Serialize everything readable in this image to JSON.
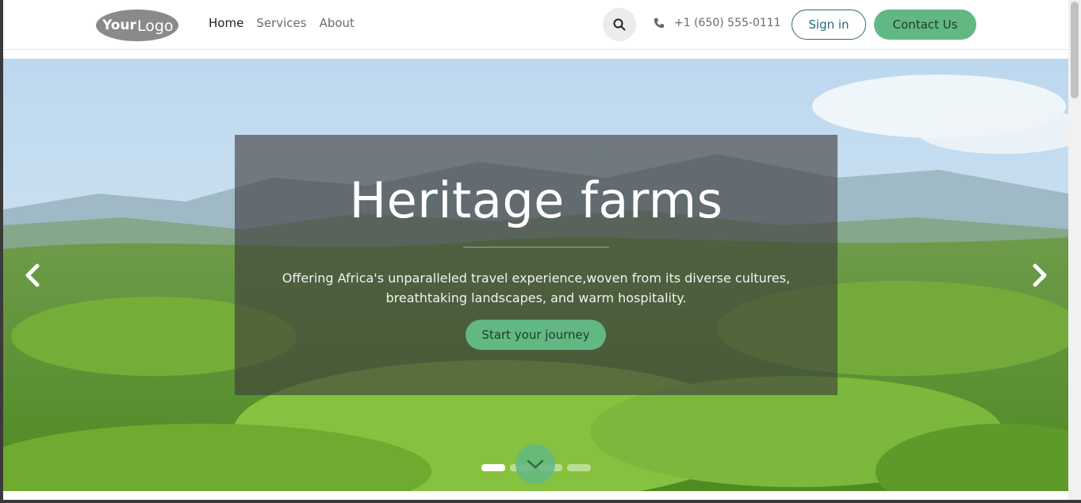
{
  "header": {
    "logo_text_bold": "Your",
    "logo_text": "Logo",
    "nav": [
      {
        "label": "Home",
        "active": true
      },
      {
        "label": "Services",
        "active": false
      },
      {
        "label": "About",
        "active": false
      }
    ],
    "search_icon": "search-icon",
    "phone_icon": "phone-icon",
    "phone": "+1 (650) 555-0111",
    "signin_label": "Sign in",
    "contact_label": "Contact Us"
  },
  "hero": {
    "title": "Heritage farms",
    "text": "Offering Africa's  unparalleled travel experience,woven from its diverse cultures, breathtaking landscapes, and warm hospitality.",
    "cta_label": "Start your journey",
    "prev_icon": "chevron-left-icon",
    "next_icon": "chevron-right-icon",
    "scroll_icon": "chevron-down-icon",
    "slides_count": 4,
    "active_slide": 1
  },
  "colors": {
    "accent": "#62b883",
    "outline": "#2a6b7c"
  }
}
